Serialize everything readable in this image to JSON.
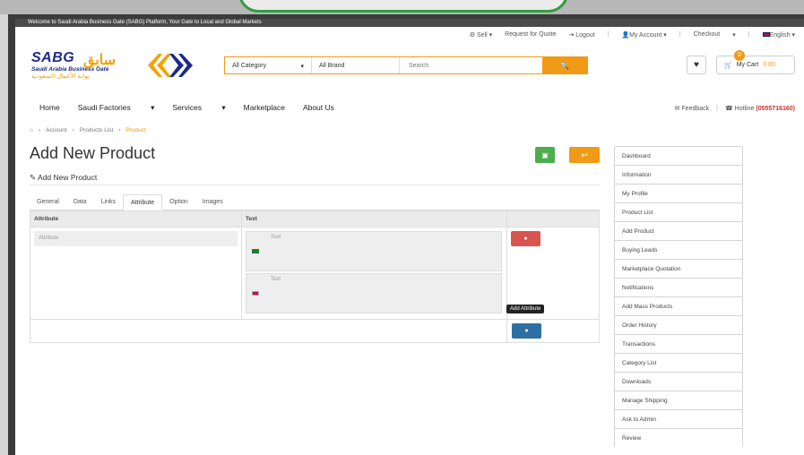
{
  "welcome_text": "Welcome to Saudi Arabia Business Gate (SABG) Platform, Your Gate to Local and Global Markets",
  "top_links": {
    "sell": "Sell",
    "rfq": "Request for Quote",
    "logout": "Logout",
    "account": "My Account",
    "checkout": "Checkout",
    "language": "English"
  },
  "logo": {
    "abbr": "SABG",
    "name": "Saudi Arabia Business Gate",
    "arabic_name": "بوابة الأعمال السعودية",
    "arabic_abbr": "سابق"
  },
  "search": {
    "category": "All Category",
    "brand": "All Brand",
    "placeholder": "Search"
  },
  "cart": {
    "count": "0",
    "label": "My Cart",
    "amount": "0.00"
  },
  "main_nav": [
    "Home",
    "Saudi Factories",
    "Services",
    "Marketplace",
    "About Us"
  ],
  "right_nav": {
    "feedback": "Feedback",
    "hotline": "Hotline",
    "phone": "(0555716160)"
  },
  "breadcrumb": [
    "Account",
    "Products List",
    "Product"
  ],
  "page_title": "Add New Product",
  "subtitle": "Add New Product",
  "tabs": [
    "General",
    "Data",
    "Links",
    "Attribute",
    "Option",
    "Images"
  ],
  "active_tab": "Attribute",
  "table": {
    "headers": [
      "Attribute",
      "Text",
      ""
    ],
    "attribute_placeholder": "Attribute",
    "text_placeholder": "Text",
    "tooltip": "Add Attribute"
  },
  "sidebar": [
    "Dashboard",
    "Information",
    "My Profile",
    "Product List",
    "Add Product",
    "Buying Leads",
    "Marketplace Quotation",
    "Notifications",
    "Add Mass Products",
    "Order History",
    "Transactions",
    "Category List",
    "Downloads",
    "Manage Shipping",
    "Ask to Admin",
    "Review"
  ],
  "colors": {
    "accent": "#f19a15",
    "primary": "#2d6fa3",
    "danger": "#d9534f",
    "success": "#4cae4c",
    "brand_blue": "#1c2a8c"
  }
}
